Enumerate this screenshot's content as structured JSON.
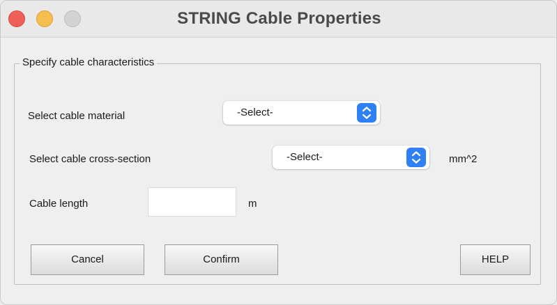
{
  "window": {
    "title": "STRING Cable Properties"
  },
  "panel": {
    "legend": "Specify cable characteristics"
  },
  "fields": {
    "material": {
      "label": "Select cable material",
      "value": "-Select-"
    },
    "cross_section": {
      "label": "Select cable cross-section",
      "value": "-Select-",
      "unit": "mm^2"
    },
    "length": {
      "label": "Cable length",
      "value": "",
      "unit": "m"
    }
  },
  "buttons": {
    "cancel": "Cancel",
    "confirm": "Confirm",
    "help": "HELP"
  },
  "colors": {
    "close": "#ee5f57",
    "minimize": "#f5be4f",
    "zoom": "#d3d3d3",
    "stepper_accent": "#2f80f4"
  },
  "icons": {
    "stepper": "chevron-up-down-icon"
  }
}
